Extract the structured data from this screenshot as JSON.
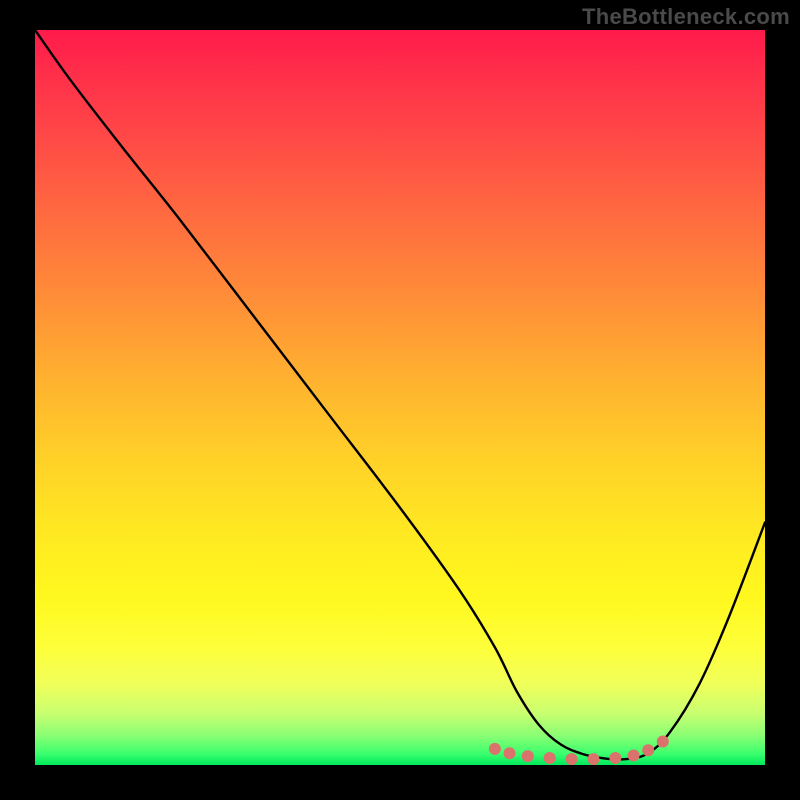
{
  "watermark": "TheBottleneck.com",
  "chart_data": {
    "type": "line",
    "title": "",
    "xlabel": "",
    "ylabel": "",
    "xlim": [
      0,
      100
    ],
    "ylim": [
      0,
      100
    ],
    "series": [
      {
        "name": "bottleneck-curve",
        "x": [
          0,
          5,
          12,
          20,
          30,
          40,
          50,
          58,
          63,
          66,
          69,
          72,
          75,
          78,
          81,
          84,
          87,
          91,
          95,
          100
        ],
        "y": [
          100,
          93,
          84,
          74,
          61,
          48,
          35,
          24,
          16,
          10,
          5.5,
          2.8,
          1.5,
          0.9,
          0.8,
          1.6,
          4.5,
          11,
          20,
          33
        ]
      }
    ],
    "markers": {
      "name": "highlight-dots",
      "x": [
        63,
        65,
        67.5,
        70.5,
        73.5,
        76.5,
        79.5,
        82,
        84,
        86
      ],
      "y": [
        2.2,
        1.6,
        1.2,
        0.95,
        0.8,
        0.8,
        0.95,
        1.3,
        2.0,
        3.2
      ],
      "color": "#d9736b",
      "radius": 6
    },
    "background": "rainbow-vertical-gradient"
  }
}
